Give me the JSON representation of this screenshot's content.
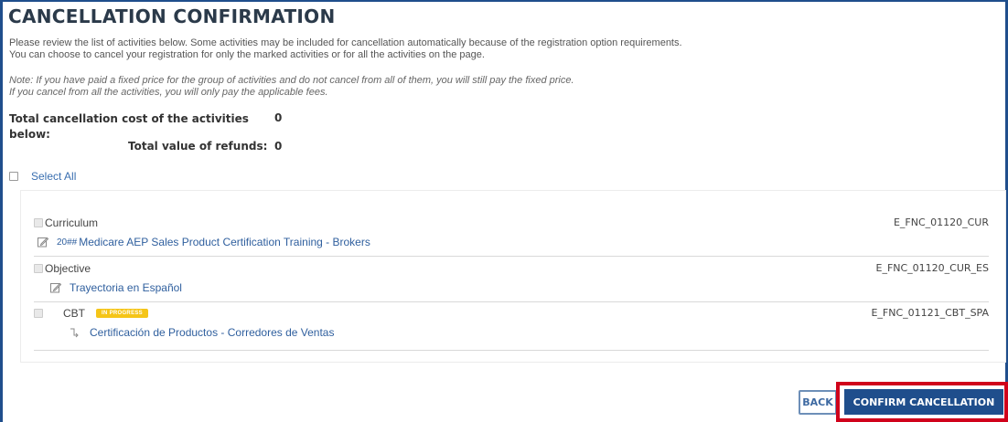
{
  "page": {
    "title": "CANCELLATION CONFIRMATION",
    "intro_line1": "Please review the list of activities below. Some activities may be included for cancellation automatically because of the registration option requirements.",
    "intro_line2": "You can choose to cancel your registration for only the marked activities or for all the activities on the page.",
    "note_line1": "Note: If you have paid a fixed price for the group of activities and do not cancel from all of them, you will still pay the fixed price.",
    "note_line2": "If you cancel from all the activities, you will only pay the applicable fees."
  },
  "summary": {
    "cost_label": "Total cancellation cost of the activities below:",
    "cost_value": "0",
    "refund_label": "Total value of refunds:",
    "refund_value": "0"
  },
  "select_all": {
    "label": "Select All"
  },
  "activities": [
    {
      "type": "Curriculum",
      "title_prefix": "20##",
      "title": "Medicare AEP Sales Product Certification Training - Brokers",
      "code": "E_FNC_01120_CUR",
      "icon": "edit-icon"
    },
    {
      "type": "Objective",
      "title": "Trayectoria en Español",
      "code": "E_FNC_01120_CUR_ES",
      "icon": "edit-icon"
    },
    {
      "type": "CBT",
      "badge": "IN PROGRESS",
      "title": "Certificación de Productos - Corredores de Ventas",
      "code": "E_FNC_01121_CBT_SPA",
      "icon": "branch-icon"
    }
  ],
  "buttons": {
    "back": "BACK",
    "confirm": "CONFIRM CANCELLATION"
  },
  "colors": {
    "accent": "#1f4e8c",
    "link": "#2f5f9e",
    "badge": "#f5c518",
    "highlight": "#d0021b"
  }
}
